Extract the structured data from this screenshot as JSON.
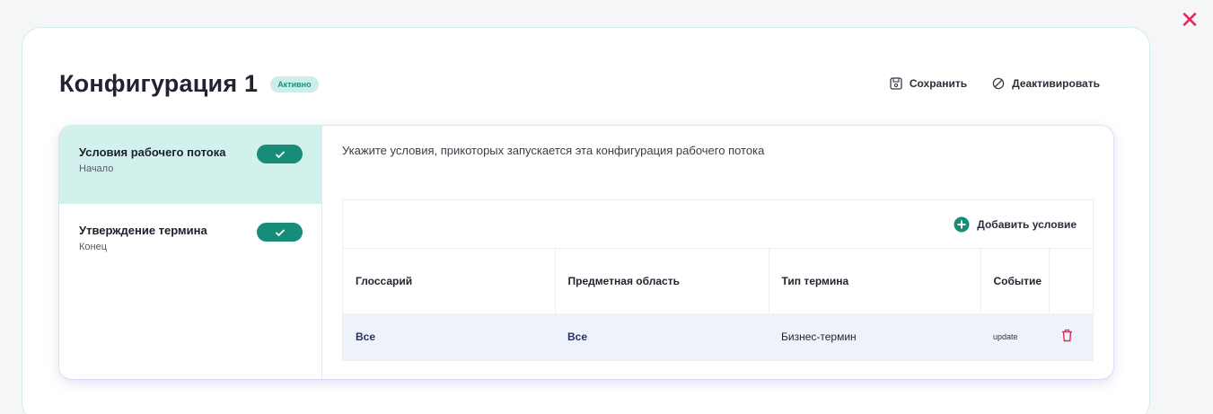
{
  "close": {
    "icon": "close-icon"
  },
  "header": {
    "title": "Конфигурация 1",
    "status": "Активно",
    "save_label": "Сохранить",
    "deactivate_label": "Деактивировать"
  },
  "steps": [
    {
      "title": "Условия рабочего потока",
      "subtitle": "Начало",
      "completed": true,
      "active": true
    },
    {
      "title": "Утверждение термина",
      "subtitle": "Конец",
      "completed": true,
      "active": false
    }
  ],
  "content": {
    "hint": "Укажите условия, прикоторых запускается эта конфигурация рабочего потока",
    "add_condition": "Добавить условие"
  },
  "table": {
    "columns": [
      "Глоссарий",
      "Предметная область",
      "Тип термина",
      "Событие",
      ""
    ],
    "rows": [
      {
        "glossary": "Все",
        "domain": "Все",
        "term_type": "Бизнес-термин",
        "event": "update"
      }
    ]
  },
  "colors": {
    "accent": "#178c78",
    "danger": "#e5275a",
    "annotation_arrow": "#f05a28"
  }
}
